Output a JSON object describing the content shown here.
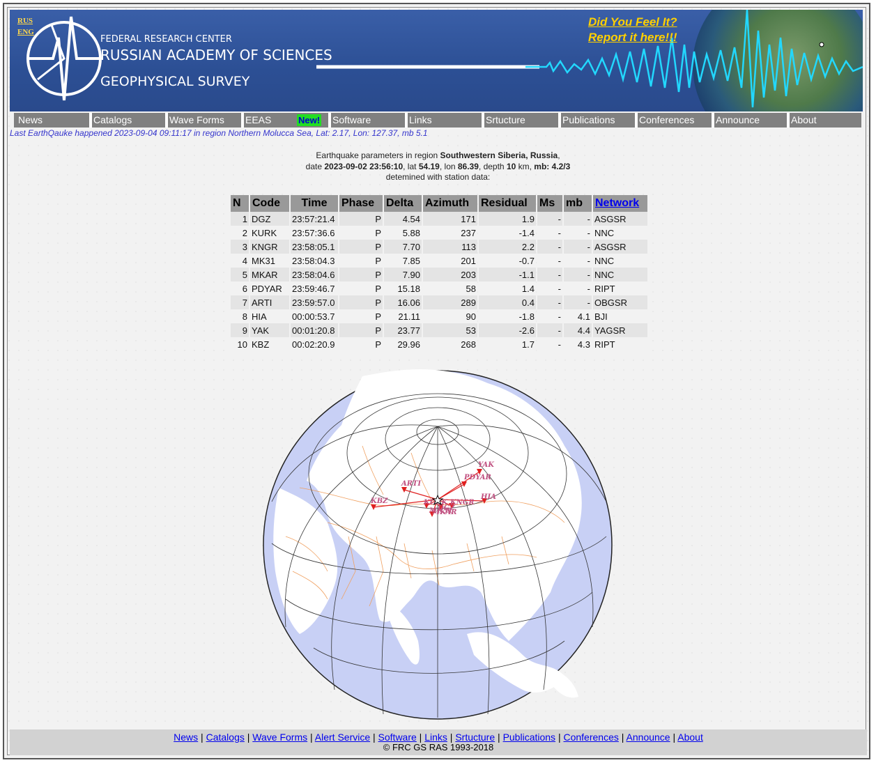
{
  "banner": {
    "lang_rus": "RUS",
    "lang_eng": "ENG",
    "line1": "FEDERAL RESEARCH CENTER",
    "line2": "RUSSIAN ACADEMY OF SCIENCES",
    "line3": "GEOPHYSICAL SURVEY",
    "feel_line1": "Did You Feel It?",
    "feel_line2": "Report it here!!!"
  },
  "nav": {
    "items": [
      "News",
      "Catalogs",
      "Wave Forms",
      "EEAS",
      "Software",
      "Links",
      "Srtucture",
      "Publications",
      "Conferences",
      "Announce",
      "About"
    ],
    "new_badge": "New!"
  },
  "ticker": "Last EarthQauke happened 2023-09-04 09:11:17 in region Northern Molucca Sea, Lat: 2.17, Lon: 127.37, mb 5.1",
  "params": {
    "prefix": "Earthquake parameters in region ",
    "region": "Southwestern Siberia, Russia",
    "date_label": "date ",
    "datetime": "2023-09-02 23:56:10",
    "lat_label": ", lat ",
    "lat": "54.19",
    "lon_label": ", lon ",
    "lon": "86.39",
    "depth_label": ", depth ",
    "depth": "10",
    "km_label": " km, ",
    "mb": "mb: 4.2/3",
    "line3": "detemined with station data:"
  },
  "table": {
    "headers": [
      "N",
      "Code",
      "Time",
      "Phase",
      "Delta",
      "Azimuth",
      "Residual",
      "Ms",
      "mb",
      "Network"
    ],
    "rows": [
      [
        "1",
        "DGZ",
        "23:57:21.4",
        "P",
        "4.54",
        "171",
        "1.9",
        "-",
        "-",
        "ASGSR"
      ],
      [
        "2",
        "KURK",
        "23:57:36.6",
        "P",
        "5.88",
        "237",
        "-1.4",
        "-",
        "-",
        "NNC"
      ],
      [
        "3",
        "KNGR",
        "23:58:05.1",
        "P",
        "7.70",
        "113",
        "2.2",
        "-",
        "-",
        "ASGSR"
      ],
      [
        "4",
        "MK31",
        "23:58:04.3",
        "P",
        "7.85",
        "201",
        "-0.7",
        "-",
        "-",
        "NNC"
      ],
      [
        "5",
        "MKAR",
        "23:58:04.6",
        "P",
        "7.90",
        "203",
        "-1.1",
        "-",
        "-",
        "NNC"
      ],
      [
        "6",
        "PDYAR",
        "23:59:46.7",
        "P",
        "15.18",
        "58",
        "1.4",
        "-",
        "-",
        "RIPT"
      ],
      [
        "7",
        "ARTI",
        "23:59:57.0",
        "P",
        "16.06",
        "289",
        "0.4",
        "-",
        "-",
        "OBGSR"
      ],
      [
        "8",
        "HIA",
        "00:00:53.7",
        "P",
        "21.11",
        "90",
        "-1.8",
        "-",
        "4.1",
        "BJI"
      ],
      [
        "9",
        "YAK",
        "00:01:20.8",
        "P",
        "23.77",
        "53",
        "-2.6",
        "-",
        "4.4",
        "YAGSR"
      ],
      [
        "10",
        "KBZ",
        "00:02:20.9",
        "P",
        "29.96",
        "268",
        "1.7",
        "-",
        "4.3",
        "RIPT"
      ]
    ]
  },
  "map": {
    "stations": [
      "YAK",
      "PDYAR",
      "ARTI",
      "KBZ",
      "KURK",
      "KNGR",
      "HIA",
      "MK31",
      "MKAR",
      "DGZ"
    ],
    "colors": {
      "ocean": "#c8d0f5",
      "land": "#ffffff",
      "border": "#f0a060",
      "graticule": "#333333",
      "ray": "#e02020",
      "label": "#c05080"
    }
  },
  "footer": {
    "links": [
      "News",
      "Catalogs",
      "Wave Forms",
      "Alert Service",
      "Software",
      "Links",
      "Srtucture",
      "Publications",
      "Conferences",
      "Announce",
      "About"
    ],
    "copyright": "© FRC GS RAS 1993-2018"
  }
}
